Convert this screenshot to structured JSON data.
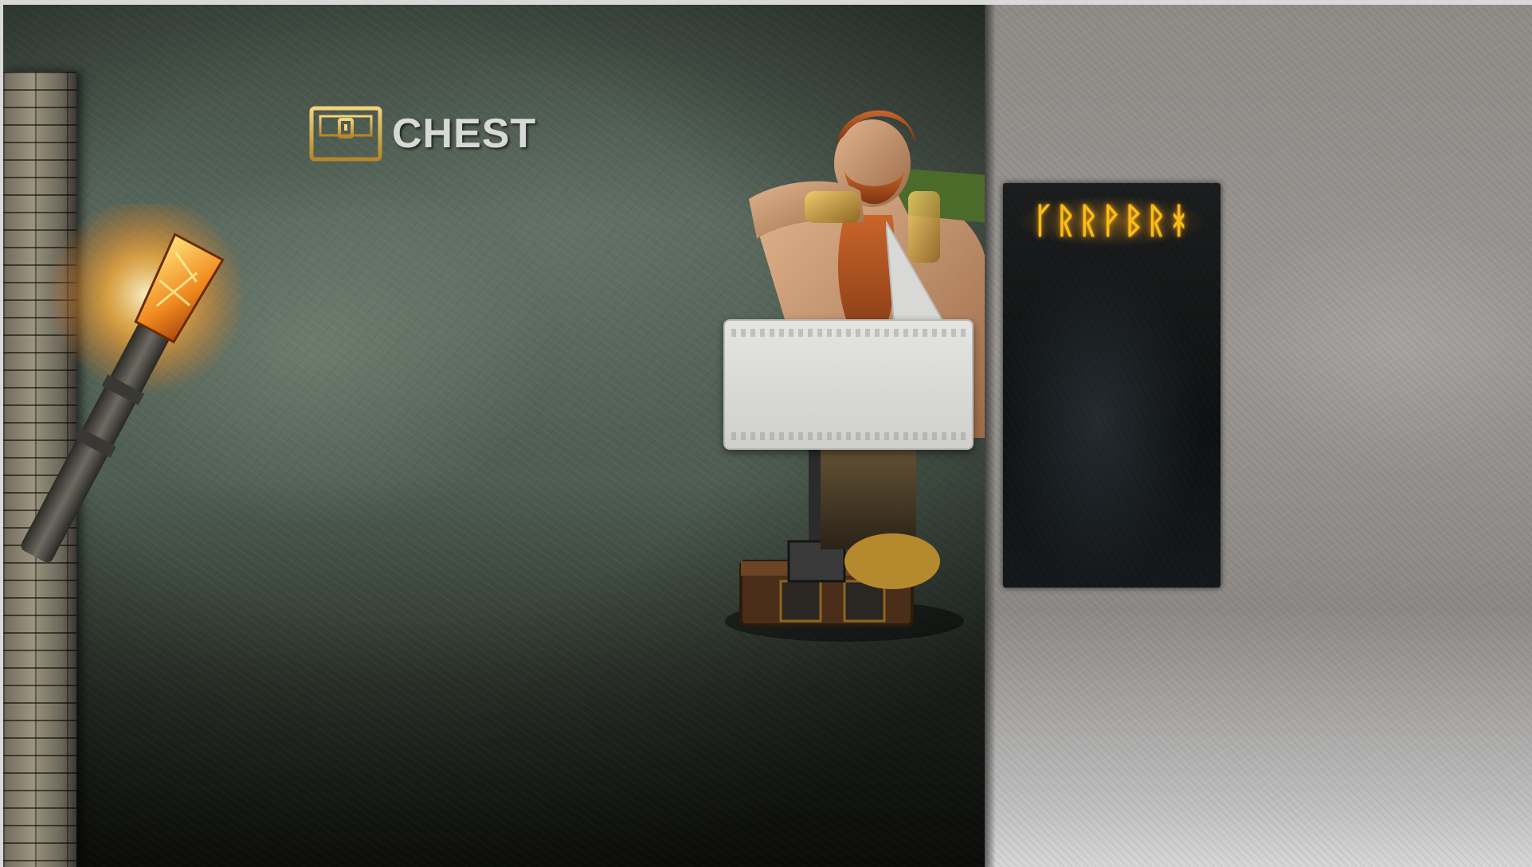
{
  "screen": {
    "title": "CHEST",
    "title_icon": "treasure-chest-icon",
    "rune_panel_label": "ᚴᚱᚱᚹᛒᚱᚼ",
    "speech_bubble_text": ""
  },
  "colors": {
    "accent_gold": "#d4a93a",
    "rune_glow": "#f2c01c",
    "title_text": "#d7d9d6"
  }
}
